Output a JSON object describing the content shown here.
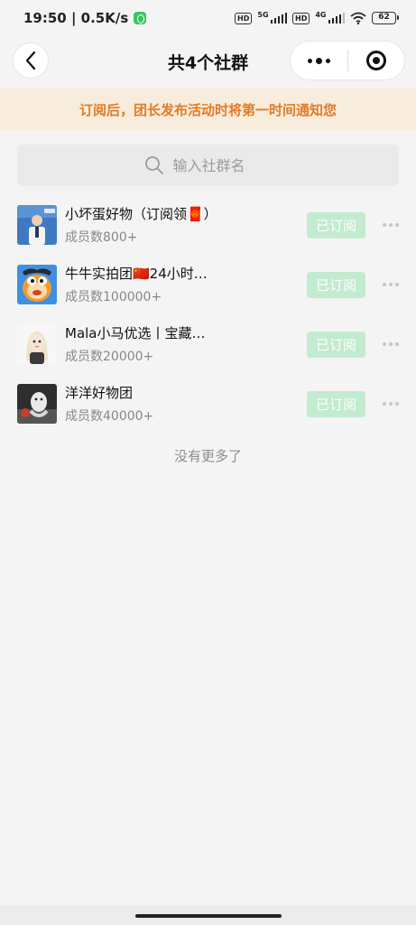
{
  "status_bar": {
    "time_speed": "19:50 | 0.5K/s",
    "hd1": "HD",
    "net1": "5G",
    "hd2": "HD",
    "net2": "4G",
    "battery": "62"
  },
  "nav": {
    "title": "共4个社群",
    "back_icon": "chevron-left-icon",
    "more_icon": "more-dots-icon",
    "close_icon": "target-icon"
  },
  "notice": "订阅后，团长发布活动时将第一时间通知您",
  "search": {
    "placeholder": "输入社群名"
  },
  "groups": [
    {
      "name": "小坏蛋好物（订阅领🧧）",
      "count": "成员数800+",
      "button": "已订阅"
    },
    {
      "name": "牛牛实拍团🇨🇳24小时…",
      "count": "成员数100000+",
      "button": "已订阅"
    },
    {
      "name": "Mala小马优选丨宝藏…",
      "count": "成员数20000+",
      "button": "已订阅"
    },
    {
      "name": "洋洋好物团",
      "count": "成员数40000+",
      "button": "已订阅"
    }
  ],
  "footer_text": "没有更多了",
  "colors": {
    "accent_orange": "#e27b24",
    "subscribed_green": "#c2ebd0"
  }
}
